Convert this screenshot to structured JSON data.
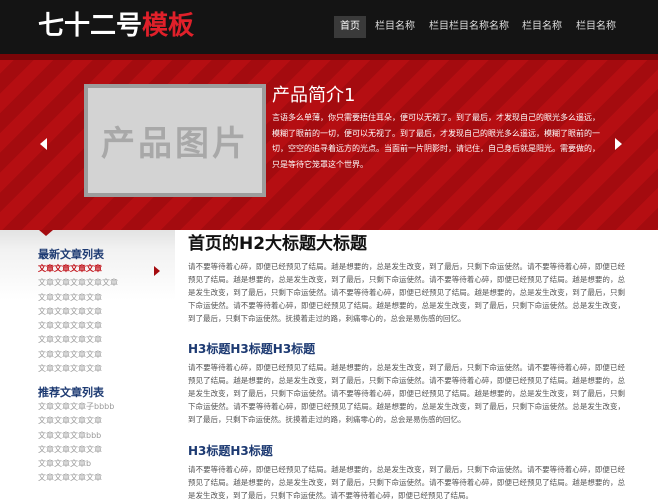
{
  "logo": {
    "white": "七十二号",
    "red": "模板"
  },
  "nav": [
    {
      "label": "首页",
      "active": true
    },
    {
      "label": "栏目名称",
      "active": false
    },
    {
      "label": "栏目栏目名称名称",
      "active": false
    },
    {
      "label": "栏目名称",
      "active": false
    },
    {
      "label": "栏目名称",
      "active": false
    }
  ],
  "banner": {
    "image_placeholder": "产品图片",
    "title": "产品简介1",
    "description": "言语多么单薄，你只需要捂住耳朵，便可以无视了。到了最后，才发现自己的眼光多么遥远，模糊了眼前的一切，便可以无视了。到了最后，才发现自己的眼光多么遥远，模糊了眼前的一切，空空的追寻着远方的光点。当面前一片阴影时，请记住，自己身后就是阳光。需要做的，只是等待它笼罩这个世界。"
  },
  "sidebar": {
    "latest_title": "最新文章列表",
    "latest_items": [
      "文章文章文章文章",
      "文章文章文章文章文章",
      "文章文章文章文章",
      "文章文章文章文章",
      "文章文章文章文章",
      "文章文章文章文章",
      "文章文章文章文章",
      "文章文章文章文章"
    ],
    "recommend_title": "推荐文章列表",
    "recommend_items": [
      "文章文章文章子bbbb",
      "文章文章文章文章",
      "文章文章文章bbb",
      "文章文章文章文章",
      "文章文章文章b",
      "文章文章文章文章"
    ]
  },
  "main": {
    "h2": "首页的H2大标题大标题",
    "para1": "请不要等待着心碎，即便已经预见了结局。越是想要的，总是发生改变，到了最后，只剩下命运使然。请不要等待着心碎，即便已经预见了结局。越是想要的，总是发生改变，到了最后，只剩下命运使然。请不要等待着心碎，即便已经预见了结局。越是想要的，总是发生改变，到了最后，只剩下命运使然。请不要等待着心碎，即便已经预见了结局。越是想要的，总是发生改变，到了最后，只剩下命运使然。请不要等待着心碎，即便已经预见了结局。越是想要的，总是发生改变，到了最后，只剩下命运使然。总是发生改变，到了最后，只剩下命运使然。抚摸着走过的路，刺痛零心的，总会是易伤感的回忆。",
    "h3_1": "H3标题H3标题H3标题",
    "para2": "请不要等待着心碎，即便已经预见了结局。越是想要的，总是发生改变，到了最后，只剩下命运使然。请不要等待着心碎，即便已经预见了结局。越是想要的，总是发生改变，到了最后，只剩下命运使然。请不要等待着心碎，即便已经预见了结局。越是想要的，总是发生改变，到了最后，只剩下命运使然。请不要等待着心碎，即便已经预见了结局。越是想要的，总是发生改变，到了最后，只剩下命运使然。请不要等待着心碎，即便已经预见了结局。越是想要的，总是发生改变，到了最后，只剩下命运使然。总是发生改变，到了最后，只剩下命运使然。抚摸着走过的路，刺痛零心的，总会是易伤感的回忆。",
    "h3_2": "H3标题H3标题",
    "para3": "请不要等待着心碎，即便已经预见了结局。越是想要的，总是发生改变，到了最后，只剩下命运使然。请不要等待着心碎，即便已经预见了结局。越是想要的，总是发生改变，到了最后，只剩下命运使然。请不要等待着心碎，即便已经预见了结局。越是想要的，总是发生改变，到了最后，只剩下命运使然。请不要等待着心碎，即便已经预见了结局。"
  }
}
